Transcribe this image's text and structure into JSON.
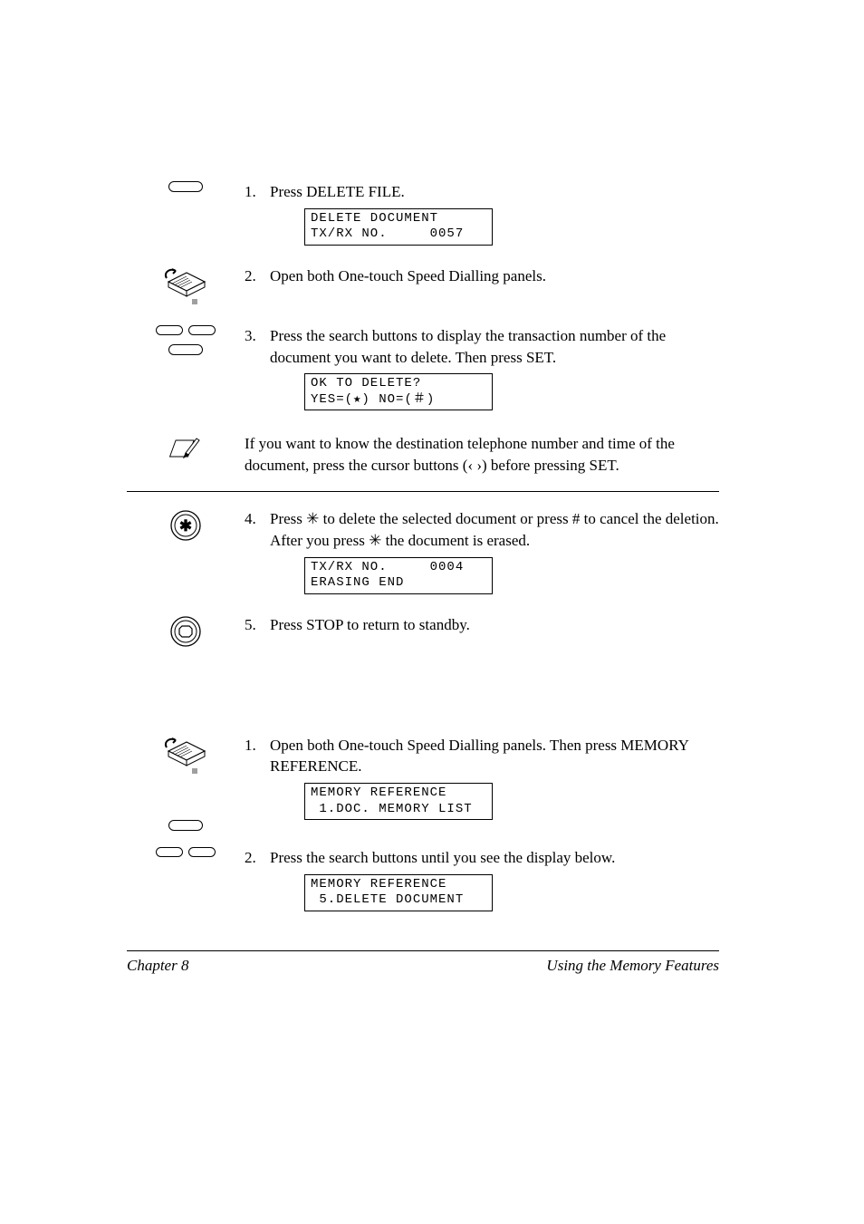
{
  "section1": {
    "steps": [
      {
        "num": "1.",
        "text": "Press DELETE FILE.",
        "lcd": "DELETE DOCUMENT\nTX/RX NO.     0057"
      },
      {
        "num": "2.",
        "text": "Open both One-touch Speed Dialling panels."
      },
      {
        "num": "3.",
        "text": "Press the search buttons to display the transaction number of the document you want to delete. Then press SET.",
        "lcd": "OK TO DELETE?\nYES=(★) NO=(＃)"
      }
    ],
    "note": "If you want to know the destination telephone number and time of the document, press the cursor buttons (‹ ›) before pressing SET.",
    "steps_after": [
      {
        "num": "4.",
        "text_a": "Press ",
        "text_b": " to delete the selected document or press # to cancel the deletion. After you press ",
        "text_c": " the document is erased.",
        "star": "✳",
        "lcd": "TX/RX NO.     0004\nERASING END"
      },
      {
        "num": "5.",
        "text": "Press STOP to return to standby."
      }
    ]
  },
  "section2": {
    "steps": [
      {
        "num": "1.",
        "text": "Open both One-touch Speed Dialling panels. Then press MEMORY REFERENCE.",
        "lcd": "MEMORY REFERENCE\n 1.DOC. MEMORY LIST"
      },
      {
        "num": "2.",
        "text": "Press the search buttons until you see the display below.",
        "lcd": "MEMORY REFERENCE\n 5.DELETE DOCUMENT"
      }
    ]
  },
  "footer": {
    "left": "Chapter 8",
    "right": "Using the Memory Features"
  }
}
